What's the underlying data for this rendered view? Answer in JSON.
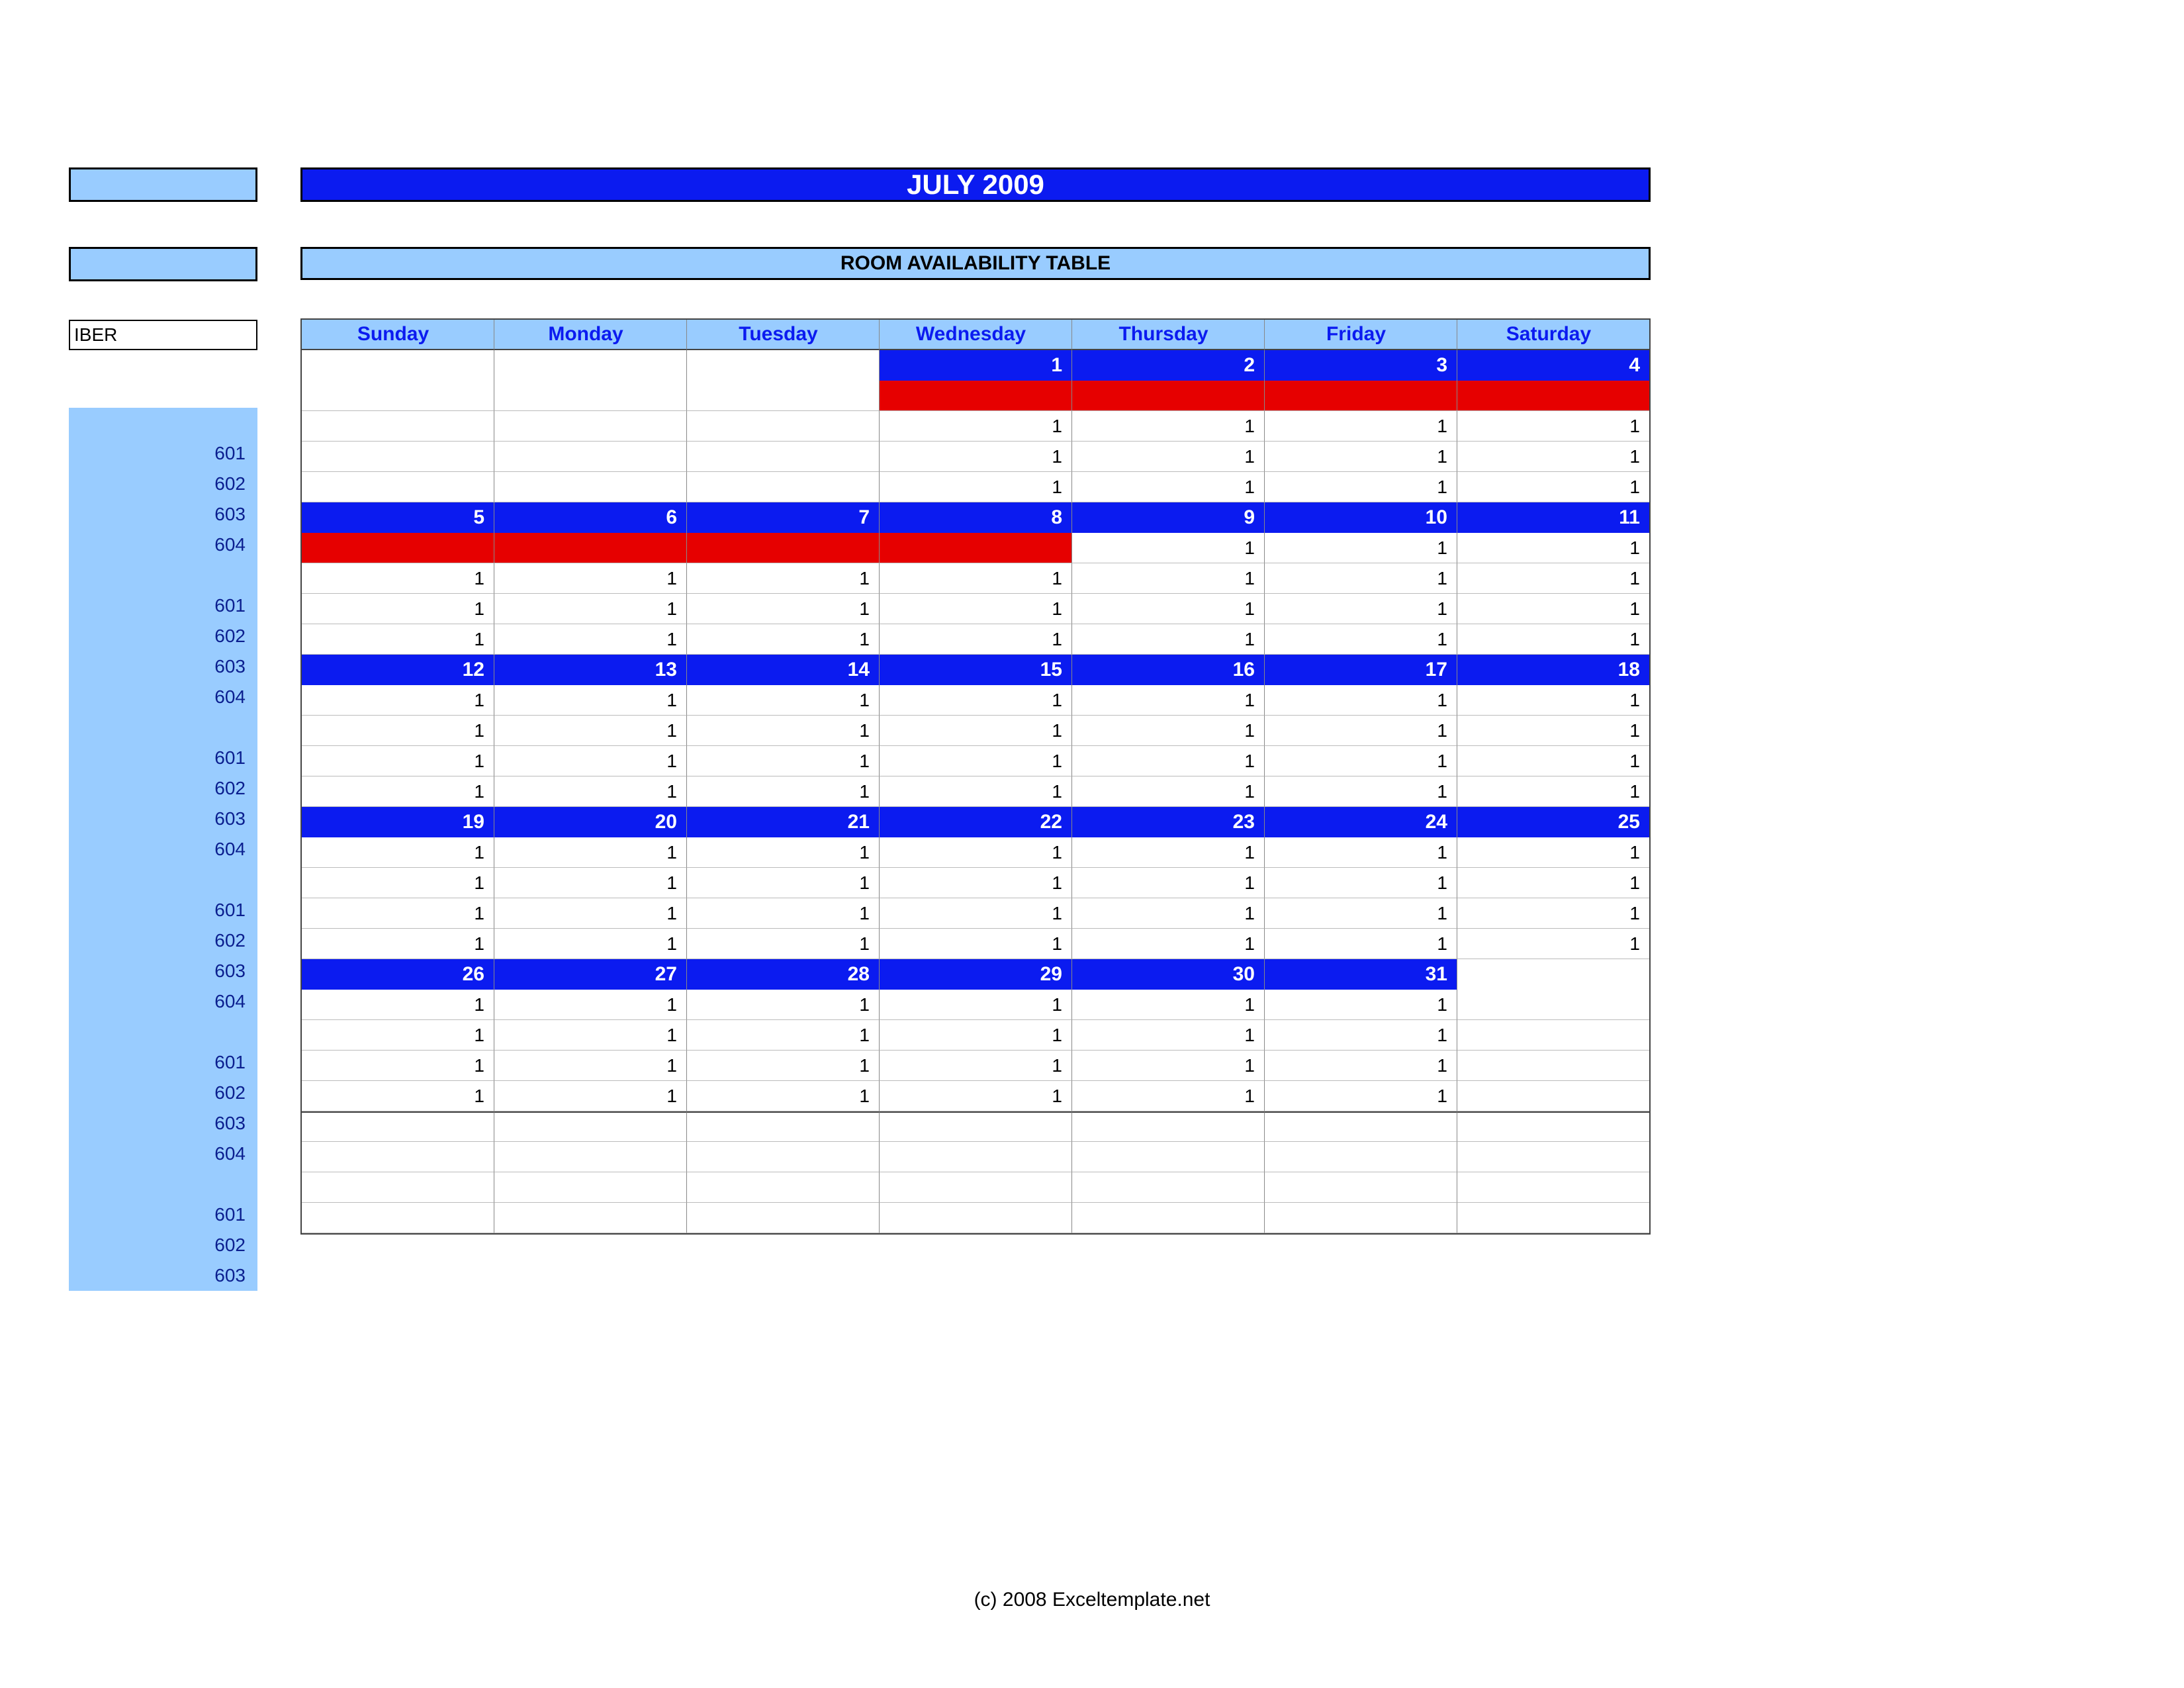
{
  "left": {
    "iber_label": "IBER"
  },
  "header": {
    "title": "JULY 2009",
    "subtitle": "ROOM AVAILABILITY TABLE"
  },
  "days": [
    "Sunday",
    "Monday",
    "Tuesday",
    "Wednesday",
    "Thursday",
    "Friday",
    "Saturday"
  ],
  "rooms": [
    "601",
    "602",
    "603",
    "604"
  ],
  "extra_rooms": [
    "601",
    "602",
    "603"
  ],
  "weeks": [
    {
      "dates": [
        "",
        "",
        "",
        "1",
        "2",
        "3",
        "4"
      ],
      "rows": [
        {
          "room": "601",
          "cells": [
            {
              "v": "",
              "red": false
            },
            {
              "v": "",
              "red": false
            },
            {
              "v": "",
              "red": false
            },
            {
              "v": "",
              "red": true
            },
            {
              "v": "",
              "red": true
            },
            {
              "v": "",
              "red": true
            },
            {
              "v": "",
              "red": true
            }
          ]
        },
        {
          "room": "602",
          "cells": [
            {
              "v": "",
              "red": false
            },
            {
              "v": "",
              "red": false
            },
            {
              "v": "",
              "red": false
            },
            {
              "v": "1",
              "red": false
            },
            {
              "v": "1",
              "red": false
            },
            {
              "v": "1",
              "red": false
            },
            {
              "v": "1",
              "red": false
            }
          ]
        },
        {
          "room": "603",
          "cells": [
            {
              "v": "",
              "red": false
            },
            {
              "v": "",
              "red": false
            },
            {
              "v": "",
              "red": false
            },
            {
              "v": "1",
              "red": false
            },
            {
              "v": "1",
              "red": false
            },
            {
              "v": "1",
              "red": false
            },
            {
              "v": "1",
              "red": false
            }
          ]
        },
        {
          "room": "604",
          "cells": [
            {
              "v": "",
              "red": false
            },
            {
              "v": "",
              "red": false
            },
            {
              "v": "",
              "red": false
            },
            {
              "v": "1",
              "red": false
            },
            {
              "v": "1",
              "red": false
            },
            {
              "v": "1",
              "red": false
            },
            {
              "v": "1",
              "red": false
            }
          ]
        }
      ]
    },
    {
      "dates": [
        "5",
        "6",
        "7",
        "8",
        "9",
        "10",
        "11"
      ],
      "rows": [
        {
          "room": "601",
          "cells": [
            {
              "v": "",
              "red": true
            },
            {
              "v": "",
              "red": true
            },
            {
              "v": "",
              "red": true
            },
            {
              "v": "",
              "red": true
            },
            {
              "v": "1",
              "red": false
            },
            {
              "v": "1",
              "red": false
            },
            {
              "v": "1",
              "red": false
            }
          ]
        },
        {
          "room": "602",
          "cells": [
            {
              "v": "1",
              "red": false
            },
            {
              "v": "1",
              "red": false
            },
            {
              "v": "1",
              "red": false
            },
            {
              "v": "1",
              "red": false
            },
            {
              "v": "1",
              "red": false
            },
            {
              "v": "1",
              "red": false
            },
            {
              "v": "1",
              "red": false
            }
          ]
        },
        {
          "room": "603",
          "cells": [
            {
              "v": "1",
              "red": false
            },
            {
              "v": "1",
              "red": false
            },
            {
              "v": "1",
              "red": false
            },
            {
              "v": "1",
              "red": false
            },
            {
              "v": "1",
              "red": false
            },
            {
              "v": "1",
              "red": false
            },
            {
              "v": "1",
              "red": false
            }
          ]
        },
        {
          "room": "604",
          "cells": [
            {
              "v": "1",
              "red": false
            },
            {
              "v": "1",
              "red": false
            },
            {
              "v": "1",
              "red": false
            },
            {
              "v": "1",
              "red": false
            },
            {
              "v": "1",
              "red": false
            },
            {
              "v": "1",
              "red": false
            },
            {
              "v": "1",
              "red": false
            }
          ]
        }
      ]
    },
    {
      "dates": [
        "12",
        "13",
        "14",
        "15",
        "16",
        "17",
        "18"
      ],
      "rows": [
        {
          "room": "601",
          "cells": [
            {
              "v": "1",
              "red": false
            },
            {
              "v": "1",
              "red": false
            },
            {
              "v": "1",
              "red": false
            },
            {
              "v": "1",
              "red": false
            },
            {
              "v": "1",
              "red": false
            },
            {
              "v": "1",
              "red": false
            },
            {
              "v": "1",
              "red": false
            }
          ]
        },
        {
          "room": "602",
          "cells": [
            {
              "v": "1",
              "red": false
            },
            {
              "v": "1",
              "red": false
            },
            {
              "v": "1",
              "red": false
            },
            {
              "v": "1",
              "red": false
            },
            {
              "v": "1",
              "red": false
            },
            {
              "v": "1",
              "red": false
            },
            {
              "v": "1",
              "red": false
            }
          ]
        },
        {
          "room": "603",
          "cells": [
            {
              "v": "1",
              "red": false
            },
            {
              "v": "1",
              "red": false
            },
            {
              "v": "1",
              "red": false
            },
            {
              "v": "1",
              "red": false
            },
            {
              "v": "1",
              "red": false
            },
            {
              "v": "1",
              "red": false
            },
            {
              "v": "1",
              "red": false
            }
          ]
        },
        {
          "room": "604",
          "cells": [
            {
              "v": "1",
              "red": false
            },
            {
              "v": "1",
              "red": false
            },
            {
              "v": "1",
              "red": false
            },
            {
              "v": "1",
              "red": false
            },
            {
              "v": "1",
              "red": false
            },
            {
              "v": "1",
              "red": false
            },
            {
              "v": "1",
              "red": false
            }
          ]
        }
      ]
    },
    {
      "dates": [
        "19",
        "20",
        "21",
        "22",
        "23",
        "24",
        "25"
      ],
      "rows": [
        {
          "room": "601",
          "cells": [
            {
              "v": "1",
              "red": false
            },
            {
              "v": "1",
              "red": false
            },
            {
              "v": "1",
              "red": false
            },
            {
              "v": "1",
              "red": false
            },
            {
              "v": "1",
              "red": false
            },
            {
              "v": "1",
              "red": false
            },
            {
              "v": "1",
              "red": false
            }
          ]
        },
        {
          "room": "602",
          "cells": [
            {
              "v": "1",
              "red": false
            },
            {
              "v": "1",
              "red": false
            },
            {
              "v": "1",
              "red": false
            },
            {
              "v": "1",
              "red": false
            },
            {
              "v": "1",
              "red": false
            },
            {
              "v": "1",
              "red": false
            },
            {
              "v": "1",
              "red": false
            }
          ]
        },
        {
          "room": "603",
          "cells": [
            {
              "v": "1",
              "red": false
            },
            {
              "v": "1",
              "red": false
            },
            {
              "v": "1",
              "red": false
            },
            {
              "v": "1",
              "red": false
            },
            {
              "v": "1",
              "red": false
            },
            {
              "v": "1",
              "red": false
            },
            {
              "v": "1",
              "red": false
            }
          ]
        },
        {
          "room": "604",
          "cells": [
            {
              "v": "1",
              "red": false
            },
            {
              "v": "1",
              "red": false
            },
            {
              "v": "1",
              "red": false
            },
            {
              "v": "1",
              "red": false
            },
            {
              "v": "1",
              "red": false
            },
            {
              "v": "1",
              "red": false
            },
            {
              "v": "1",
              "red": false
            }
          ]
        }
      ]
    },
    {
      "dates": [
        "26",
        "27",
        "28",
        "29",
        "30",
        "31",
        ""
      ],
      "rows": [
        {
          "room": "601",
          "cells": [
            {
              "v": "1",
              "red": false
            },
            {
              "v": "1",
              "red": false
            },
            {
              "v": "1",
              "red": false
            },
            {
              "v": "1",
              "red": false
            },
            {
              "v": "1",
              "red": false
            },
            {
              "v": "1",
              "red": false
            },
            {
              "v": "",
              "red": false
            }
          ]
        },
        {
          "room": "602",
          "cells": [
            {
              "v": "1",
              "red": false
            },
            {
              "v": "1",
              "red": false
            },
            {
              "v": "1",
              "red": false
            },
            {
              "v": "1",
              "red": false
            },
            {
              "v": "1",
              "red": false
            },
            {
              "v": "1",
              "red": false
            },
            {
              "v": "",
              "red": false
            }
          ]
        },
        {
          "room": "603",
          "cells": [
            {
              "v": "1",
              "red": false
            },
            {
              "v": "1",
              "red": false
            },
            {
              "v": "1",
              "red": false
            },
            {
              "v": "1",
              "red": false
            },
            {
              "v": "1",
              "red": false
            },
            {
              "v": "1",
              "red": false
            },
            {
              "v": "",
              "red": false
            }
          ]
        },
        {
          "room": "604",
          "cells": [
            {
              "v": "1",
              "red": false
            },
            {
              "v": "1",
              "red": false
            },
            {
              "v": "1",
              "red": false
            },
            {
              "v": "1",
              "red": false
            },
            {
              "v": "1",
              "red": false
            },
            {
              "v": "1",
              "red": false
            },
            {
              "v": "",
              "red": false
            }
          ]
        }
      ]
    }
  ],
  "footer": "(c) 2008 Exceltemplate.net"
}
